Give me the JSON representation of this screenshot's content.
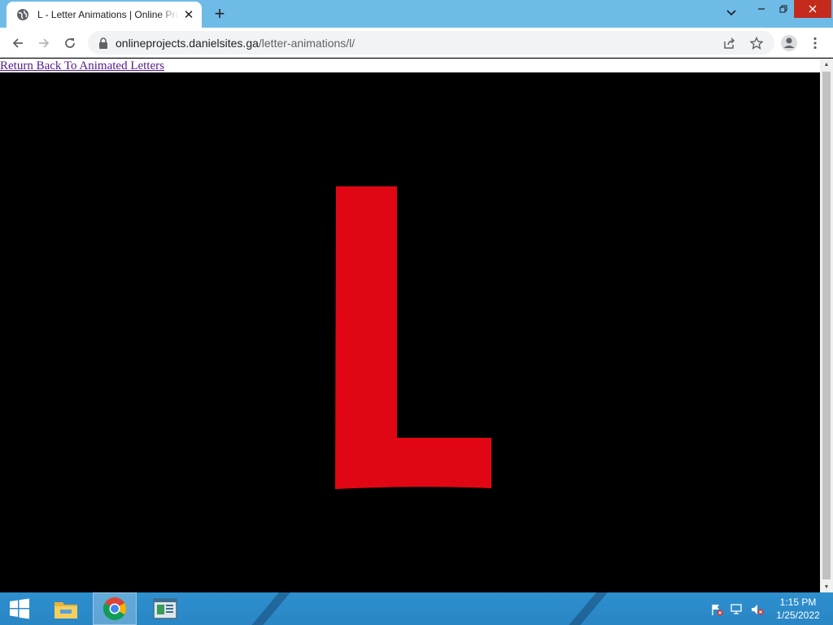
{
  "browser": {
    "tab": {
      "title": "L - Letter Animations | Online Projects",
      "favicon": "globe-icon"
    },
    "new_tab_label": "+",
    "url": {
      "host": "onlineprojects.danielsites.ga",
      "path": "/letter-animations/l/"
    },
    "icons": {
      "back": "arrow-left-icon",
      "forward": "arrow-right-icon",
      "reload": "reload-icon",
      "lock": "lock-icon",
      "share": "share-icon",
      "bookmark": "star-icon",
      "profile": "person-icon",
      "menu": "kebab-menu-icon"
    },
    "window_controls": {
      "tab_search": "⌄",
      "minimize": "—",
      "maximize": "❐",
      "close": "✕"
    }
  },
  "page": {
    "return_link": "Return Back To Animated Letters",
    "letter": "L",
    "letter_color": "#e10613",
    "background_color": "#000000"
  },
  "taskbar": {
    "clock": {
      "time": "1:15 PM",
      "date": "1/25/2022"
    },
    "apps": [
      "windows-start-icon",
      "file-explorer-icon",
      "chrome-icon",
      "app-window-icon"
    ],
    "tray": [
      "action-center-flag-icon",
      "network-icon",
      "volume-muted-icon"
    ]
  },
  "colors": {
    "tabstrip": "#6fbbe8",
    "taskbar": "#2e8fcf",
    "link": "#551a8b"
  }
}
